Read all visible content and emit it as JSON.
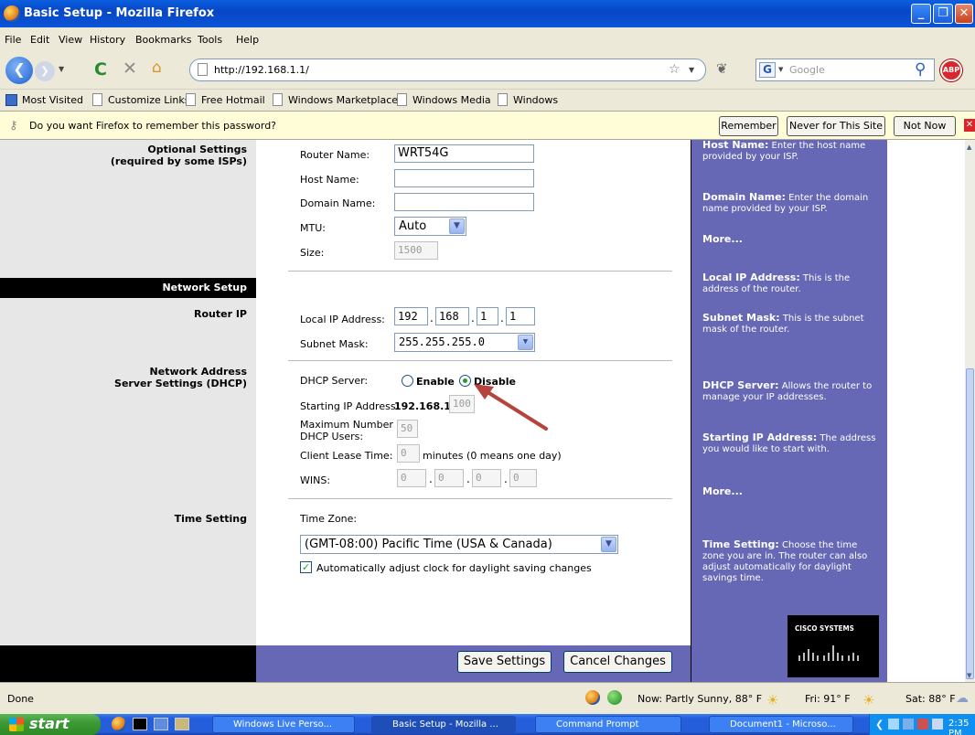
{
  "window": {
    "title": "Basic Setup - Mozilla Firefox"
  },
  "menu": [
    "File",
    "Edit",
    "View",
    "History",
    "Bookmarks",
    "Tools",
    "Help"
  ],
  "nav": {
    "url": "http://192.168.1.1/",
    "search_placeholder": "Google"
  },
  "bookmarks": [
    "Most Visited",
    "Customize Links",
    "Free Hotmail",
    "Windows Marketplace",
    "Windows Media",
    "Windows"
  ],
  "notification": {
    "message": "Do you want Firefox to remember this password?",
    "remember": "Remember",
    "never": "Never for This Site",
    "not_now": "Not Now"
  },
  "sections": {
    "optional_line1": "Optional Settings",
    "optional_line2": "(required by some ISPs)",
    "network_setup": "Network Setup",
    "router_ip": "Router IP",
    "nas_line1": "Network Address",
    "nas_line2": "Server Settings (DHCP)",
    "time_setting": "Time Setting"
  },
  "optional": {
    "router_name_label": "Router Name:",
    "router_name": "WRT54G",
    "host_name_label": "Host Name:",
    "host_name": "",
    "domain_name_label": "Domain Name:",
    "domain_name": "",
    "mtu_label": "MTU:",
    "mtu": "Auto",
    "size_label": "Size:",
    "size": "1500"
  },
  "router_ip": {
    "local_ip_label": "Local IP Address:",
    "ip": [
      "192",
      "168",
      "1",
      "1"
    ],
    "subnet_label": "Subnet Mask:",
    "subnet": "255.255.255.0"
  },
  "dhcp": {
    "server_label": "DHCP Server:",
    "enable": "Enable",
    "disable": "Disable",
    "selected": "Disable",
    "start_ip_label": "Starting IP Address:",
    "start_ip_prefix": "192.168.1.",
    "start_ip_last": "100",
    "max_users_line1": "Maximum Number of",
    "max_users_line2": "DHCP Users:",
    "max_users": "50",
    "lease_label": "Client Lease Time:",
    "lease": "0",
    "lease_suffix": "minutes (0 means one day)",
    "wins_label": "WINS:",
    "wins": [
      "0",
      "0",
      "0",
      "0"
    ]
  },
  "time": {
    "zone_label": "Time Zone:",
    "zone": "(GMT-08:00) Pacific Time (USA & Canada)",
    "dst_label": "Automatically adjust clock for daylight saving changes",
    "dst_checked": true
  },
  "help": {
    "host_title": "Host Name:",
    "host_text": "Enter the host name provided by your ISP.",
    "domain_title": "Domain Name:",
    "domain_text": "Enter the domain name provided by your ISP.",
    "more": "More...",
    "localip_title": "Local IP Address:",
    "localip_text": "This is the address of the router.",
    "subnet_title": "Subnet Mask:",
    "subnet_text": "This is the subnet mask of the router.",
    "dhcp_title": "DHCP Server:",
    "dhcp_text": "Allows the router to manage your IP addresses.",
    "startip_title": "Starting IP Address:",
    "startip_text": "The address you would like to start with.",
    "time_title": "Time Setting:",
    "time_text": "Choose the time zone you are in. The router can also adjust automatically for daylight savings time.",
    "brand": "CISCO SYSTEMS"
  },
  "buttons": {
    "save": "Save Settings",
    "cancel": "Cancel Changes"
  },
  "status": {
    "text": "Done",
    "weather_now": "Now: Partly Sunny, 88° F",
    "weather_fri": "Fri: 91° F",
    "weather_sat": "Sat: 88° F"
  },
  "taskbar": {
    "start": "start",
    "tasks": [
      "Windows Live Perso...",
      "Basic Setup - Mozilla ...",
      "Command Prompt",
      "Document1 - Microso..."
    ],
    "clock": "2:35 PM"
  },
  "colors": {
    "accent": "#6667b5",
    "titlebar": "#0a55d8",
    "arrow": "#b5443f"
  }
}
